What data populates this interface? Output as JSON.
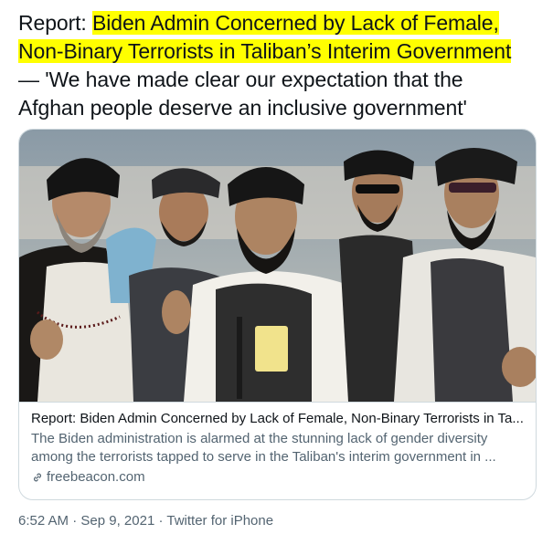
{
  "tweet": {
    "prefix": "Report: ",
    "highlight_line1": "Biden Admin Concerned by Lack of Female,",
    "highlight_line2": "Non-Binary Terrorists in Taliban’s Interim Government",
    "line3": "— 'We have made clear our expectation that the",
    "line4": "Afghan people deserve an inclusive government'",
    "highlight_color": "#ffff00"
  },
  "card": {
    "title": "Report: Biden Admin Concerned by Lack of Female, Non-Binary Terrorists in Ta...",
    "description_line1": "The Biden administration is alarmed at the stunning lack of gender diversity",
    "description_line2": "among the terrorists tapped to serve in the Taliban's interim government in ...",
    "domain": "freebeacon.com",
    "domain_icon": "link-icon"
  },
  "meta": {
    "time": "6:52 AM",
    "date": "Sep 9, 2021",
    "source": "Twitter for iPhone",
    "separator": " · "
  }
}
